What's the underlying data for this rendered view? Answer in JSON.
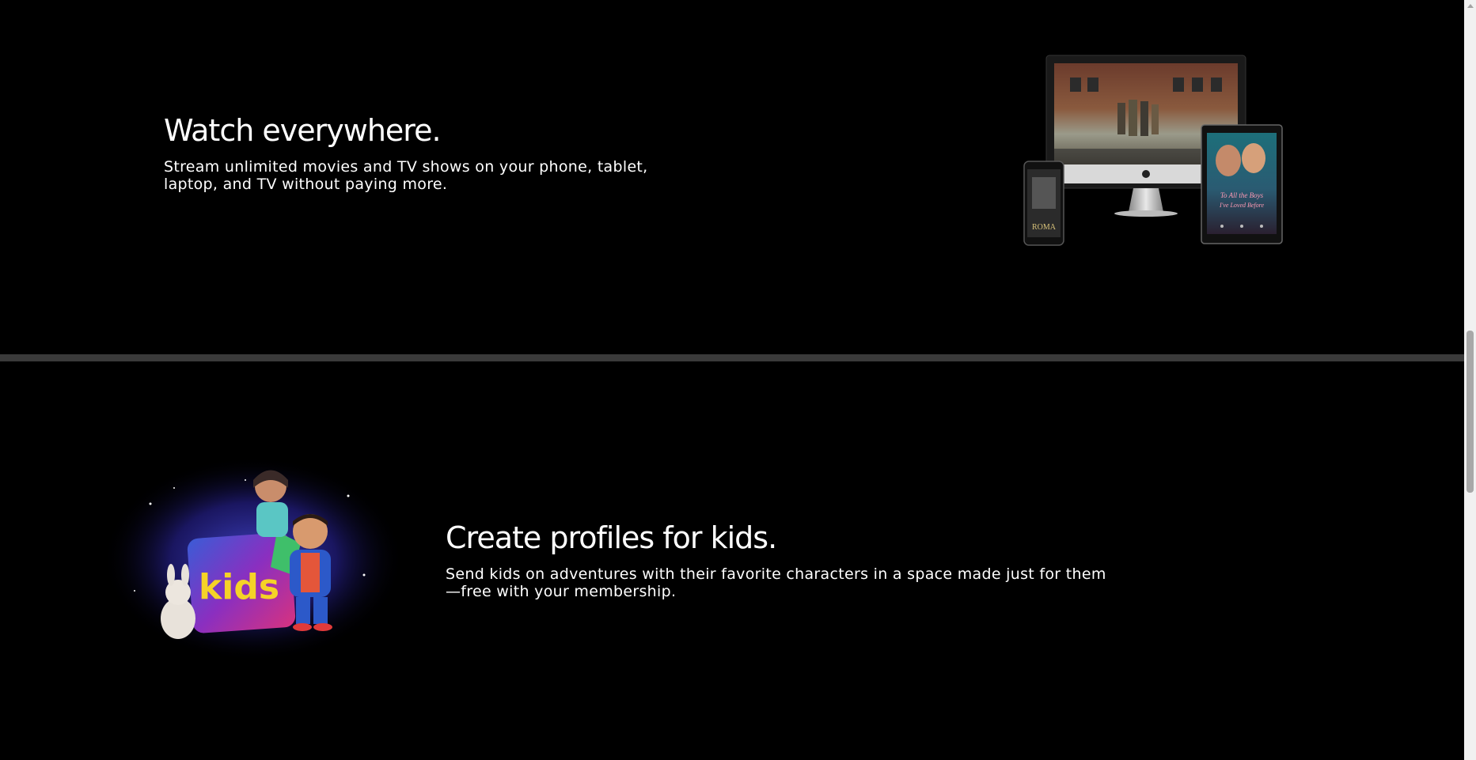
{
  "watch_section": {
    "title": "Watch everywhere.",
    "description": "Stream unlimited movies and TV shows on your phone, tablet, laptop, and TV without paying more.",
    "devices": {
      "phone_poster_title": "ROMA",
      "tablet_poster_title_line1": "To All the Boys",
      "tablet_poster_title_line2": "I've Loved Before"
    }
  },
  "kids_section": {
    "title": "Create profiles for kids.",
    "description": "Send kids on adventures with their favorite characters in a space made just for them—free with your membership.",
    "badge_text": "kids"
  },
  "colors": {
    "background": "#000000",
    "divider": "#3a3a3a",
    "text": "#ffffff",
    "kids_badge_text": "#f5d327"
  }
}
